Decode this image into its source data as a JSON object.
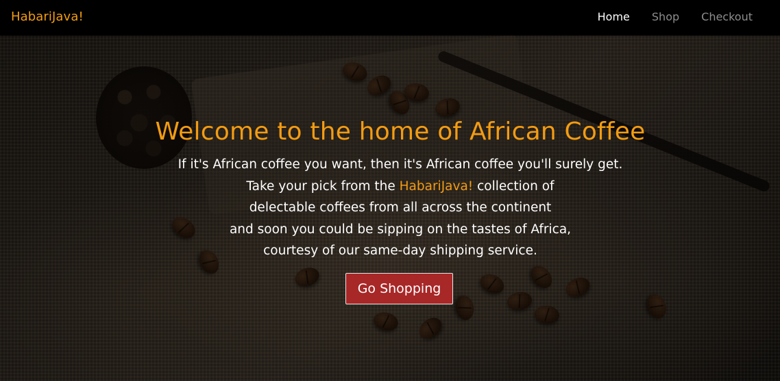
{
  "navbar": {
    "brand": "HabariJava!",
    "links": [
      {
        "label": "Home",
        "active": true
      },
      {
        "label": "Shop",
        "active": false
      },
      {
        "label": "Checkout",
        "active": false
      }
    ]
  },
  "hero": {
    "title": "Welcome to the home of African Coffee",
    "lines": {
      "line1": "If it's African coffee you want, then it's African coffee you'll surely get.",
      "line2_before": "Take your pick from the ",
      "line2_brand": "HabariJava!",
      "line2_after": " collection of",
      "line3": "delectable coffees from all across the continent",
      "line4": "and soon you could be sipping on the tastes of Africa,",
      "line5": "courtesy of our same-day shipping service."
    },
    "cta_label": "Go Shopping"
  },
  "colors": {
    "brand": "#f39c12",
    "cta_background": "#a82727",
    "navbar_background": "#000000",
    "nav_active": "#ffffff",
    "nav_inactive": "#8d8d8d"
  }
}
